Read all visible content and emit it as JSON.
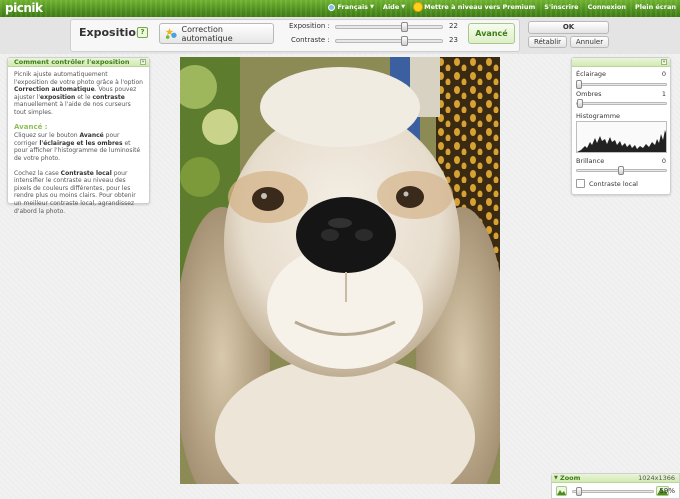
{
  "app": {
    "logo": "picnik"
  },
  "topnav": {
    "language": "Français",
    "help": "Aide",
    "premium": "Mettre à niveau vers Premium",
    "signup": "S'inscrire",
    "login": "Connexion",
    "fullscreen": "Plein écran"
  },
  "toolbar": {
    "title": "Exposition",
    "help_label": "?",
    "auto_label": "Correction automatique",
    "exposure_label": "Exposition :",
    "exposure_value": "22",
    "exposure_level": 0.67,
    "contrast_label": "Contraste :",
    "contrast_value": "23",
    "contrast_level": 0.67,
    "advanced_label": "Avancé",
    "ok_label": "OK",
    "reset_label": "Rétablir",
    "cancel_label": "Annuler"
  },
  "help_panel": {
    "title": "Comment contrôler l'exposition",
    "p1_a": "Picnik ajuste automatiquement l'exposition de votre photo grâce à l'option ",
    "p1_b": "Correction automatique",
    "p1_c": ". Vous pouvez ajuster l'",
    "p1_d": "exposition",
    "p1_e": " et le ",
    "p1_f": "contraste",
    "p1_g": " manuellement à l'aide de nos curseurs tout simples.",
    "adv_title": "Avancé :",
    "p2_a": "Cliquez sur le bouton ",
    "p2_b": "Avancé",
    "p2_c": " pour corriger ",
    "p2_d": "l'éclairage et les ombres",
    "p2_e": " et pour afficher l'histogramme de luminosité de votre photo.",
    "p3_a": "Cochez la case ",
    "p3_b": "Contraste local",
    "p3_c": " pour intensifier le contraste au niveau des pixels de couleurs différentes, pour les rendre plus ou moins clairs. Pour obtenir un meilleur contraste local, agrandissez d'abord la photo."
  },
  "advanced_panel": {
    "lighting_label": "Éclairage",
    "lighting_value": "0",
    "lighting_level": 0,
    "shadows_label": "Ombres",
    "shadows_value": "1",
    "shadows_level": 0.01,
    "histogram_label": "Histogramme",
    "brightness_label": "Brillance",
    "brightness_value": "0",
    "brightness_level": 0.5,
    "local_contrast_label": "Contraste local",
    "local_contrast_checked": false
  },
  "zoom": {
    "label": "Zoom",
    "dimensions": "1024x1366",
    "percent": "59%",
    "level": 0.05
  },
  "photo": {
    "subject": "dog-portrait"
  },
  "colors": {
    "accent_green": "#3e7d18",
    "panel_header": "#d2eab2",
    "topbar_green": "#4d8f1d"
  }
}
